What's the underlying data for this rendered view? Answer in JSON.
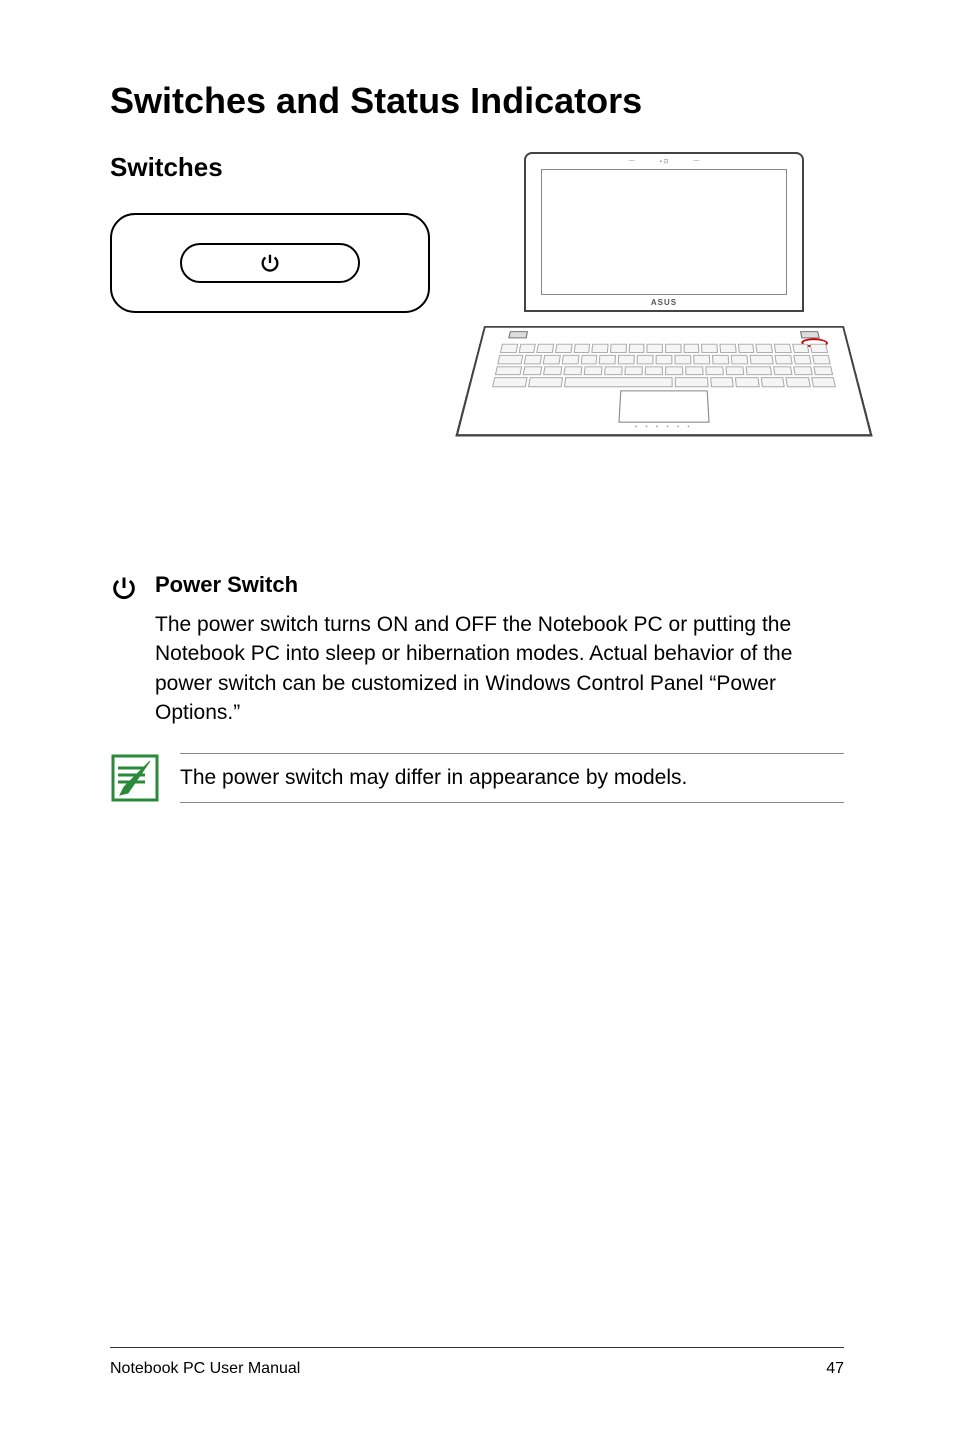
{
  "heading": "Switches and Status Indicators",
  "switches": {
    "title": "Switches",
    "brand": "ASUS"
  },
  "power_switch": {
    "title": "Power Switch",
    "body": "The power switch turns ON and OFF the Notebook PC or putting the Notebook PC into sleep or hibernation modes. Actual behavior of the power switch can be customized in Windows Control Panel “Power Options.”"
  },
  "note": {
    "text": "The power switch may differ in appearance by models."
  },
  "footer": {
    "left": "Notebook PC User Manual",
    "right": "47"
  }
}
